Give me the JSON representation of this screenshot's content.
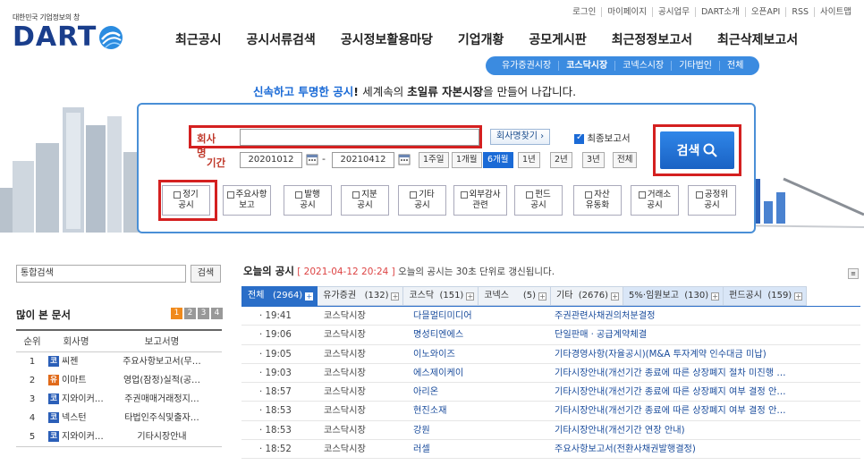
{
  "util_links": [
    "로그인",
    "마이페이지",
    "공시업무",
    "DART소개",
    "오픈API",
    "RSS",
    "사이트맵"
  ],
  "logo": {
    "tagline": "대한민국 기업정보의 창",
    "word": "DART"
  },
  "gnb": [
    "최근공시",
    "공시서류검색",
    "공시정보활용마당",
    "기업개황",
    "공모게시판",
    "최근정정보고서",
    "최근삭제보고서"
  ],
  "subnav": [
    {
      "label": "유가증권시장",
      "active": false
    },
    {
      "label": "코스닥시장",
      "active": true
    },
    {
      "label": "코넥스시장",
      "active": false
    },
    {
      "label": "기타법인",
      "active": false
    },
    {
      "label": "전체",
      "active": false
    }
  ],
  "slogan": {
    "p1": "신속하고 투명한 공시",
    "p2": "! ",
    "p3": "세계속의 ",
    "p4": "초일류 자본시장",
    "p5": "을 만들어 나갑니다."
  },
  "search": {
    "company_label": "회사명",
    "company_value": "",
    "find_company": "회사명찾기 ›",
    "final_report": "최종보고서",
    "period_label": "기간",
    "date_from": "20201012",
    "date_to": "20210412",
    "period_buttons": [
      {
        "label": "1주일",
        "active": false
      },
      {
        "label": "1개월",
        "active": false
      },
      {
        "label": "6개월",
        "active": true
      },
      {
        "label": "1년",
        "active": false
      },
      {
        "label": "2년",
        "active": false
      },
      {
        "label": "3년",
        "active": false
      },
      {
        "label": "전체",
        "active": false
      }
    ],
    "search_button": "검색",
    "categories": [
      [
        "정기",
        "공시"
      ],
      [
        "주요사항",
        "보고"
      ],
      [
        "발행",
        "공시"
      ],
      [
        "지분",
        "공시"
      ],
      [
        "기타",
        "공시"
      ],
      [
        "외부감사",
        "관련"
      ],
      [
        "펀드",
        "공시"
      ],
      [
        "자산",
        "유동화"
      ],
      [
        "거래소",
        "공시"
      ],
      [
        "공정위",
        "공시"
      ]
    ]
  },
  "unified_search": {
    "placeholder": "통합검색",
    "button": "검색"
  },
  "popular": {
    "title": "많이 본 문서",
    "pages": [
      "1",
      "2",
      "3",
      "4"
    ],
    "headers": [
      "순위",
      "회사명",
      "보고서명"
    ],
    "rows": [
      {
        "rank": "1",
        "market": "코",
        "company": "씨젠",
        "report": "주요사항보고서(무…"
      },
      {
        "rank": "2",
        "market": "유",
        "company": "이마트",
        "report": "영업(잠정)실적(공…"
      },
      {
        "rank": "3",
        "market": "코",
        "company": "지와이커…",
        "report": "주권매매거래정지…"
      },
      {
        "rank": "4",
        "market": "코",
        "company": "넥스턴",
        "report": "타법인주식및출자…"
      },
      {
        "rank": "5",
        "market": "코",
        "company": "지와이커…",
        "report": "기타시장안내"
      }
    ]
  },
  "today": {
    "title": "오늘의 공시",
    "timestamp": "[ 2021-04-12 20:24 ]",
    "note": "오늘의 공시는 30초 단위로 갱신됩니다.",
    "tabs": [
      {
        "label": "전체",
        "count": "(2964)",
        "style": "on"
      },
      {
        "label": "유가증권",
        "count": "(132)",
        "style": ""
      },
      {
        "label": "코스닥",
        "count": "(151)",
        "style": ""
      },
      {
        "label": "코넥스",
        "count": "(5)",
        "style": ""
      },
      {
        "label": "기타",
        "count": "(2676)",
        "style": ""
      },
      {
        "label": "5%·임원보고",
        "count": "(130)",
        "style": "bl"
      },
      {
        "label": "펀드공시",
        "count": "(159)",
        "style": "bl"
      }
    ],
    "rows": [
      {
        "time": "· 19:41",
        "market": "코스닥시장",
        "company": "다믈멀티미디어",
        "report": "주권관련사채권의처분결정"
      },
      {
        "time": "· 19:06",
        "market": "코스닥시장",
        "company": "명성티엔에스",
        "report": "단일판매ㆍ공급계약체결"
      },
      {
        "time": "· 19:05",
        "market": "코스닥시장",
        "company": "이노와이즈",
        "report": "기타경영사항(자율공시)(M&A 투자계약 인수대금 미납)"
      },
      {
        "time": "· 19:03",
        "market": "코스닥시장",
        "company": "에스제이케이",
        "report": "기타시장안내(개선기간 종료에 따른 상장폐지 절차 미진행 …"
      },
      {
        "time": "· 18:57",
        "market": "코스닥시장",
        "company": "아리온",
        "report": "기타시장안내(개선기간 종료에 따른 상장폐지 여부 결정 안…"
      },
      {
        "time": "· 18:53",
        "market": "코스닥시장",
        "company": "현진소재",
        "report": "기타시장안내(개선기간 종료에 따른 상장폐지 여부 결정 안…"
      },
      {
        "time": "· 18:53",
        "market": "코스닥시장",
        "company": "강원",
        "report": "기타시장안내(개선기간 연장 안내)"
      },
      {
        "time": "· 18:52",
        "market": "코스닥시장",
        "company": "러셀",
        "report": "주요사항보고서(전환사채권발행결정)"
      }
    ]
  }
}
